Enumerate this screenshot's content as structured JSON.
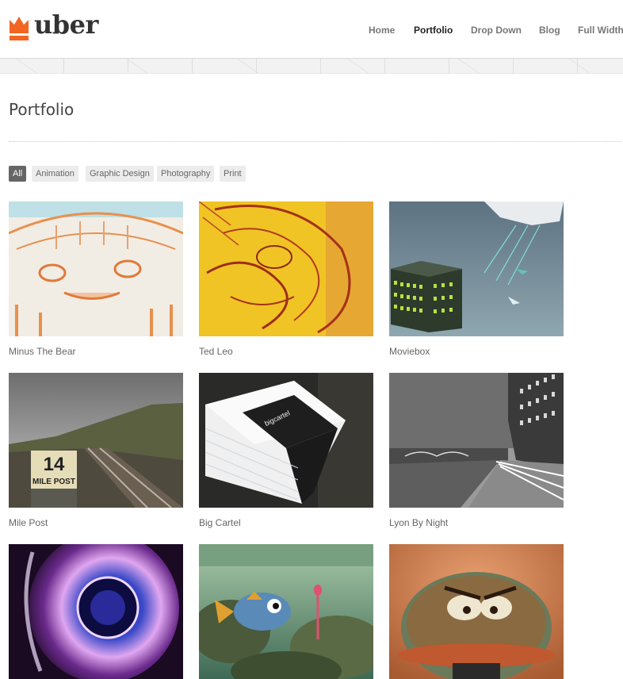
{
  "brand": {
    "name": "uber",
    "accent": "#f26522"
  },
  "nav": {
    "items": [
      {
        "label": "Home",
        "active": false
      },
      {
        "label": "Portfolio",
        "active": true
      },
      {
        "label": "Drop Down",
        "active": false
      },
      {
        "label": "Blog",
        "active": false
      },
      {
        "label": "Full Width",
        "active": false
      }
    ]
  },
  "page": {
    "title": "Portfolio"
  },
  "filters": [
    {
      "label": "All",
      "active": true
    },
    {
      "label": "Animation",
      "active": false
    },
    {
      "label": "Graphic Design",
      "active": false
    },
    {
      "label": "Photography",
      "active": false
    },
    {
      "label": "Print",
      "active": false
    }
  ],
  "portfolio": [
    {
      "title": "Minus The Bear"
    },
    {
      "title": "Ted Leo"
    },
    {
      "title": "Moviebox"
    },
    {
      "title": "Mile Post"
    },
    {
      "title": "Big Cartel"
    },
    {
      "title": "Lyon By Night"
    },
    {
      "title": ""
    },
    {
      "title": ""
    },
    {
      "title": ""
    }
  ],
  "thumbnails": {
    "milepost_sign_number": "14",
    "milepost_sign_text": "MILE POST",
    "bigcartel_label": "bigcartel"
  }
}
